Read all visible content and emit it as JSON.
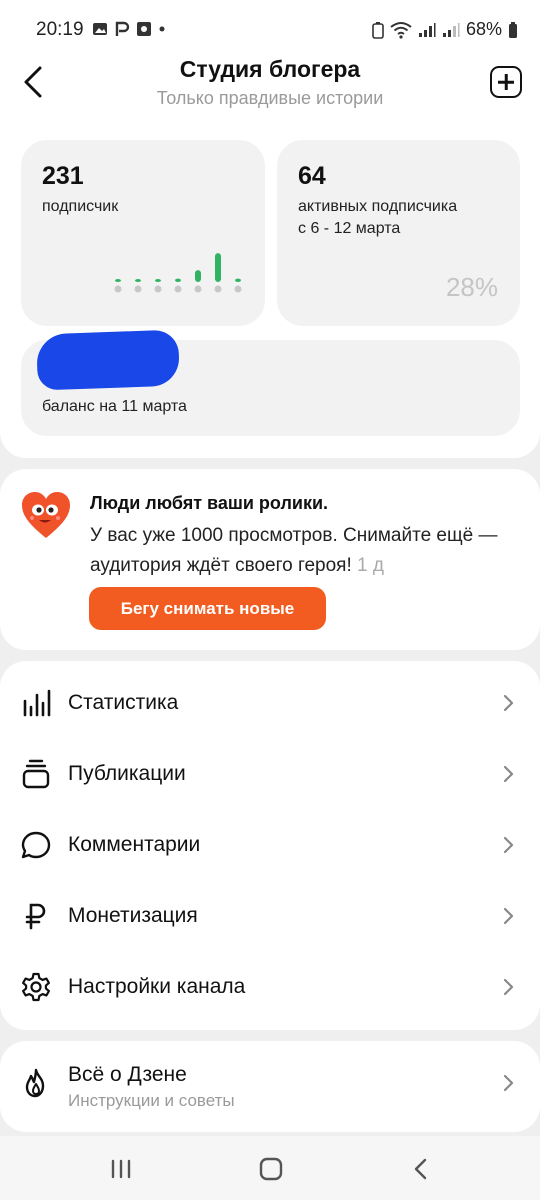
{
  "status_bar": {
    "time": "20:19",
    "battery": "68%"
  },
  "header": {
    "title": "Студия блогера",
    "subtitle": "Только правдивые истории"
  },
  "stats": {
    "subscribers": {
      "value": "231",
      "label": "подписчик"
    },
    "active": {
      "value": "64",
      "label_line1": "активных подписчика",
      "label_line2": "с 6 - 12 марта",
      "percent": "28%"
    },
    "balance": {
      "label": "баланс на 11 марта"
    },
    "mini_chart_levels": [
      0.05,
      0.05,
      0.05,
      0.1,
      0.35,
      0.85,
      0.1
    ]
  },
  "promo": {
    "title": "Люди любят ваши ролики.",
    "text": "У вас уже 1000 просмотров. Снимайте ещё — аудитория ждёт своего героя!",
    "age": "1 д",
    "button": "Бегу снимать новые"
  },
  "menu": {
    "items": [
      {
        "label": "Статистика",
        "icon": "bar-chart-icon"
      },
      {
        "label": "Публикации",
        "icon": "stack-icon"
      },
      {
        "label": "Комментарии",
        "icon": "speech-bubble-icon"
      },
      {
        "label": "Монетизация",
        "icon": "ruble-icon"
      },
      {
        "label": "Настройки канала",
        "icon": "gear-icon"
      }
    ]
  },
  "info": {
    "title": "Всё о Дзене",
    "subtitle": "Инструкции и советы",
    "icon": "flame-icon"
  },
  "colors": {
    "accent": "#f25c20",
    "chart_green": "#2fb463",
    "redact": "#1947e8"
  }
}
